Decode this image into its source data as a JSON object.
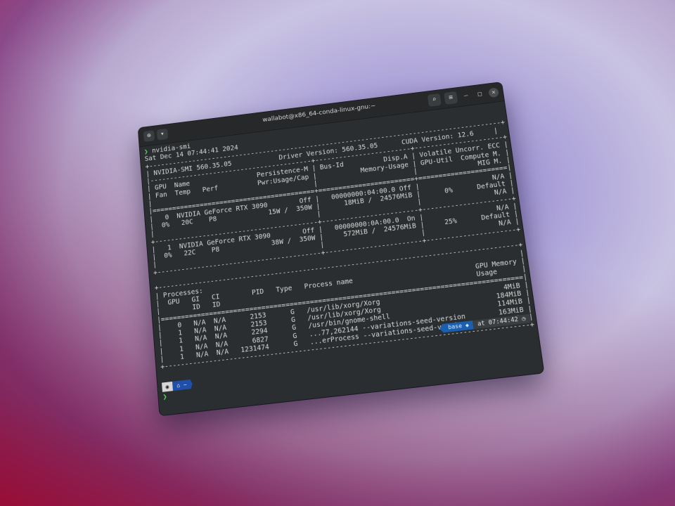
{
  "window": {
    "title": "wallabot@x86_64-conda-linux-gnu:~",
    "new_tab_icon": "new-tab-icon",
    "menu_icon": "chevron-down-icon"
  },
  "terminal": {
    "prompt_symbol": "❯",
    "command": "nvidia-smi",
    "lines": [
      "Sat Dec 14 07:44:41 2024",
      "+-----------------------------------------------------------------------------------------+",
      "| NVIDIA-SMI 560.35.05            Driver Version: 560.35.05      CUDA Version: 12.6     |",
      "|-----------------------------------------+------------------------+----------------------+",
      "| GPU  Name                 Persistence-M | Bus-Id          Disp.A | Volatile Uncorr. ECC |",
      "| Fan  Temp   Perf          Pwr:Usage/Cap |           Memory-Usage | GPU-Util  Compute M. |",
      "|                                         |                        |               MIG M. |",
      "|=========================================+========================+======================|",
      "|   0  NVIDIA GeForce RTX 3090        Off |   00000000:04:00.0 Off |                  N/A |",
      "|  0%   20C    P8             15W /  350W |      18MiB /  24576MiB |      0%      Default |",
      "|                                         |                        |                  N/A |",
      "+-----------------------------------------+------------------------+----------------------+",
      "|   1  NVIDIA GeForce RTX 3090        Off |   00000000:0A:00.0  On |                  N/A |",
      "|  0%   22C    P8             38W /  350W |     572MiB /  24576MiB |     25%      Default |",
      "|                                         |                        |                  N/A |",
      "+-----------------------------------------+------------------------+----------------------+",
      "",
      "+-----------------------------------------------------------------------------------------+",
      "| Processes:                                                                              |",
      "|  GPU   GI   CI        PID   Type   Process name                              GPU Memory |",
      "|        ID   ID                                                               Usage      |",
      "|=========================================================================================|",
      "|    0   N/A  N/A      2153      G   /usr/lib/xorg/Xorg                              4MiB |",
      "|    1   N/A  N/A      2153      G   /usr/lib/xorg/Xorg                            184MiB |",
      "|    1   N/A  N/A      2294      G   /usr/bin/gnome-shell                          114MiB |",
      "|    1   N/A  N/A      6827      G   ...77,262144 --variations-seed-version        163MiB |",
      "|    1   N/A  N/A   1231474      G   ...erProcess --variations-seed-version         81MiB |",
      "+-----------------------------------------------------------------------------------------+"
    ]
  },
  "prompt": {
    "os_icon": "ubuntu-icon",
    "dir_glyph": "⌂",
    "dir": "~",
    "env": "base",
    "env_glyph": "◆",
    "time_prefix": "at",
    "time": "07:44:42",
    "clock_glyph": "◷"
  }
}
